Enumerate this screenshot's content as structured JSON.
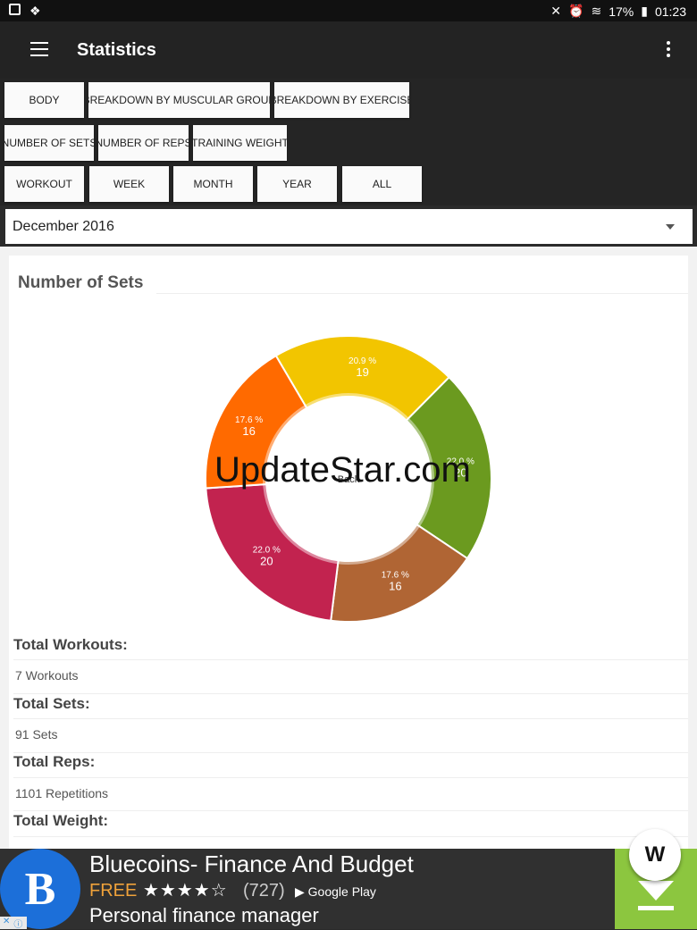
{
  "status_bar": {
    "battery": "17%",
    "time": "01:23",
    "icons": [
      "gallery-icon",
      "dropbox-icon",
      "mute-icon",
      "alarm-icon",
      "wifi-icon",
      "battery-icon"
    ]
  },
  "app_bar": {
    "title": "Statistics",
    "menu_icon": "hamburger-icon",
    "overflow_icon": "more-vert-icon"
  },
  "breakdown_buttons": [
    "BODY",
    "BREAKDOWN BY MUSCULAR GROUP",
    "BREAKDOWN BY EXERCISE"
  ],
  "metric_buttons": [
    "NUMBER OF SETS",
    "NUMBER OF REPS",
    "TRAINING WEIGHT"
  ],
  "period_buttons": [
    "WORKOUT",
    "WEEK",
    "MONTH",
    "YEAR",
    "ALL"
  ],
  "selected": {
    "breakdown": "BREAKDOWN BY MUSCULAR GROUP",
    "metric": "NUMBER OF SETS",
    "period": "MONTH"
  },
  "period_select": {
    "value": "December 2016"
  },
  "card": {
    "title": "Number of Sets"
  },
  "chart_data": {
    "type": "pie",
    "donut": true,
    "center_label": "Back",
    "slices": [
      {
        "pct_label": "22.0 %",
        "value": 20,
        "color": "#6b9a1f"
      },
      {
        "pct_label": "17.6 %",
        "value": 16,
        "color": "#b06534"
      },
      {
        "pct_label": "22.0 %",
        "value": 20,
        "color": "#c2234f"
      },
      {
        "pct_label": "17.6 %",
        "value": 16,
        "color": "#ff6a00"
      },
      {
        "pct_label": "20.9 %",
        "value": 19,
        "color": "#f2c500"
      }
    ]
  },
  "watermark": "UpdateStar.com",
  "stats": [
    {
      "label": "Total Workouts:",
      "value": "7 Workouts"
    },
    {
      "label": "Total Sets:",
      "value": "91 Sets"
    },
    {
      "label": "Total Reps:",
      "value": "1101 Repetitions"
    },
    {
      "label": "Total Weight:",
      "value": ""
    }
  ],
  "ad": {
    "logo_letter": "B",
    "title": "Bluecoins- Finance And Budget",
    "free": "FREE",
    "stars": "★★★★☆",
    "count": "(727)",
    "store": "Google Play",
    "subtitle": "Personal finance manager",
    "fab_letter": "W",
    "colors": {
      "logo": "#1c6fd9",
      "download": "#8cc63f",
      "free": "#f0a23a"
    }
  }
}
